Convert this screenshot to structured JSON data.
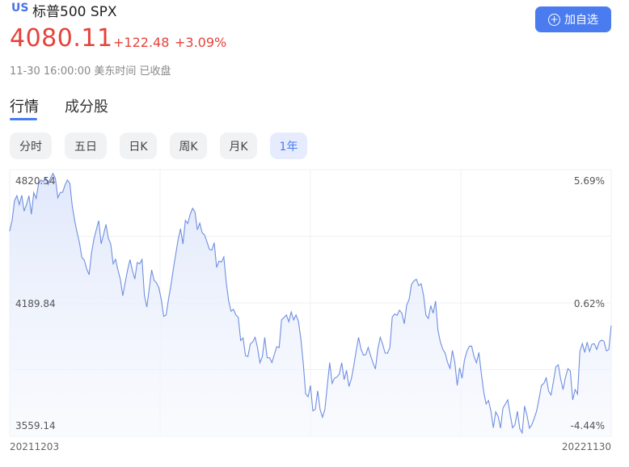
{
  "header": {
    "market_badge": "US",
    "index_name": "标普500 SPX",
    "price": "4080.11",
    "change": "+122.48",
    "change_pct": "+3.09%",
    "timestamp": "11-30 16:00:00 美东时间 已收盘",
    "add_button_label": "加自选"
  },
  "tabs": [
    {
      "label": "行情",
      "active": true
    },
    {
      "label": "成分股",
      "active": false
    }
  ],
  "periods": [
    {
      "label": "分时",
      "active": false
    },
    {
      "label": "五日",
      "active": false
    },
    {
      "label": "日K",
      "active": false
    },
    {
      "label": "周K",
      "active": false
    },
    {
      "label": "月K",
      "active": false
    },
    {
      "label": "1年",
      "active": true
    }
  ],
  "colors": {
    "up": "#e8413a",
    "accent": "#4a7cf0",
    "line": "#6f8fe0"
  },
  "chart_data": {
    "type": "area",
    "title": "",
    "xlabel": "",
    "ylabel": "",
    "x_start_label": "20211203",
    "x_end_label": "20221130",
    "ylim": [
      3559.14,
      4820.54
    ],
    "y_tick_labels": [
      "4820.54",
      "4189.84",
      "3559.14"
    ],
    "y_right_tick_labels": [
      "5.69%",
      "0.62%",
      "-4.44%"
    ],
    "grid": true,
    "values": [
      4538,
      4591,
      4686,
      4710,
      4667,
      4712,
      4635,
      4668,
      4710,
      4620,
      4725,
      4697,
      4767,
      4786,
      4778,
      4796,
      4765,
      4796,
      4818,
      4793,
      4700,
      4725,
      4727,
      4762,
      4786,
      4770,
      4660,
      4590,
      4532,
      4482,
      4410,
      4398,
      4356,
      4327,
      4432,
      4500,
      4546,
      4589,
      4477,
      4521,
      4571,
      4504,
      4475,
      4380,
      4402,
      4350,
      4304,
      4225,
      4290,
      4350,
      4400,
      4348,
      4306,
      4386,
      4380,
      4401,
      4225,
      4170,
      4260,
      4350,
      4300,
      4288,
      4263,
      4207,
      4125,
      4131,
      4208,
      4275,
      4354,
      4426,
      4498,
      4550,
      4476,
      4590,
      4575,
      4619,
      4649,
      4631,
      4545,
      4577,
      4530,
      4520,
      4486,
      4450,
      4446,
      4482,
      4362,
      4393,
      4388,
      4413,
      4290,
      4200,
      4150,
      4159,
      4132,
      4120,
      4008,
      4020,
      3935,
      3930,
      3991,
      4001,
      4023,
      3973,
      3900,
      3930,
      4023,
      3924,
      3924,
      3901,
      3941,
      3978,
      3974,
      4109,
      4119,
      4132,
      4099,
      4146,
      4108,
      4132,
      4101,
      4017,
      3900,
      3750,
      3735,
      3790,
      3667,
      3674,
      3764,
      3674,
      3636,
      3674,
      3790,
      3900,
      3800,
      3825,
      3831,
      3845,
      3900,
      3818,
      3863,
      3785,
      3822,
      3885,
      3958,
      4023,
      3966,
      3937,
      3940,
      3974,
      3935,
      3899,
      3870,
      3966,
      4023,
      3991,
      3948,
      3946,
      3974,
      4122,
      4136,
      4130,
      4155,
      4140,
      4089,
      4180,
      4207,
      4280,
      4297,
      4305,
      4274,
      4283,
      4228,
      4130,
      4115,
      4177,
      4140,
      4199,
      4057,
      4000,
      3966,
      3946,
      3901,
      3873,
      3960,
      3901,
      3790,
      3875,
      3825,
      3913,
      3955,
      3980,
      3981,
      3930,
      3900,
      3950,
      3850,
      3760,
      3700,
      3717,
      3667,
      3585,
      3662,
      3640,
      3583,
      3680,
      3700,
      3720,
      3650,
      3585,
      3600,
      3665,
      3580,
      3560,
      3690,
      3645,
      3583,
      3600,
      3630,
      3666,
      3725,
      3790,
      3800,
      3827,
      3762,
      3744,
      3810,
      3880,
      3890,
      3820,
      3770,
      3830,
      3872,
      3860,
      3720,
      3770,
      3748,
      3956,
      3993,
      3950,
      4000,
      3955,
      3990,
      3992,
      3965,
      4000,
      4010,
      4004,
      3958,
      3964,
      4080
    ]
  }
}
